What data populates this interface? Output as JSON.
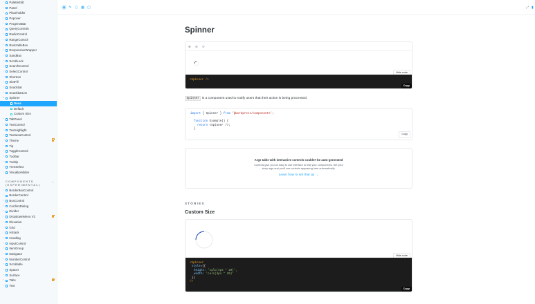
{
  "sidebar": {
    "items_top": [
      "PaletteEdit",
      "Panel",
      "Placeholder",
      "Popover",
      "ProgressBar",
      "QueryControls",
      "RadioControl",
      "RangeControl",
      "ResizableBox",
      "ResponsiveWrapper",
      "SandBox",
      "ScrollLock",
      "SearchControl",
      "SelectControl",
      "Shortcut",
      "SlotFill",
      "Snackbar",
      "SnackbarList",
      "Spinner"
    ],
    "spinner_children": [
      "Docs",
      "Default",
      "Custom Size"
    ],
    "items_after": [
      "TabPanel",
      "TextControl",
      "TextHighlight",
      "TextareaControl",
      "Theme",
      "Tip",
      "ToggleControl",
      "Toolbar",
      "Tooltip",
      "TreeSelect",
      "VisuallyHidden"
    ],
    "section_header": "COMPONENTS (EXPERIMENTAL)",
    "experimental_items": [
      "BorderBoxControl",
      "BorderControl",
      "BoxControl",
      "ConfirmDialog",
      "Divider",
      "DropdownMenu V2",
      "Elevation",
      "Grid",
      "HStack",
      "Heading",
      "InputControl",
      "ItemGroup",
      "Navigator",
      "NumberControl",
      "Scrollable",
      "Spacer",
      "Surface",
      "Tabs",
      "Text"
    ]
  },
  "main": {
    "title": "Spinner",
    "hide_code_label": "Hide code",
    "copy_label": "Copy",
    "first_code": "<Spinner />",
    "desc_code": "Spinner",
    "desc_text": " is a component used to notify users that their action is being processed.",
    "import_kw": "import",
    "import_braces": " { Spinner } ",
    "from_kw": "from",
    "import_str": " '@wordpress/components';",
    "function_kw": "function",
    "function_name": " Example() {",
    "return_kw": "return",
    "return_body": " <Spinner />;",
    "close_brace": "}",
    "args_title": "Args table with interactive controls couldn't be auto-generated",
    "args_text": "Controls give you an easy to use interface to test your components. Set your story args and you'll see controls appearing here automatically.",
    "args_link": "Learn how to set that up →",
    "stories_label": "STORIES",
    "story_title": "Custom Size",
    "custom_code": {
      "l1_tag": "<Spinner",
      "l2_attr": "style",
      "l2_rest": "={{",
      "l3_key": "height:",
      "l3_val": " 'calc(4px * 20)',",
      "l4_key": "width:",
      "l4_val": " 'calc(4px * 20)'",
      "l5": "}}",
      "l6": "/>"
    }
  }
}
